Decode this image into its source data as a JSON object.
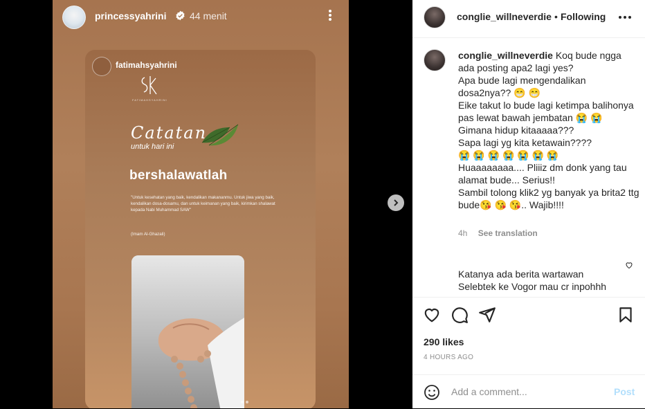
{
  "story": {
    "username": "princessyahrini",
    "time": "44 menit",
    "card": {
      "username": "fatimahsyahrini",
      "logo_text": "FATIMAHSYAHRINI",
      "catatan": "Catatan",
      "untuk": "untuk hari ini",
      "headline": "bershalawatlah",
      "quote": "\"Untuk kesehatan yang baik, kendalikan makananmu. Untuk jiwa yang baik, kendalikan dosa-dosamu, dan untuk keimanan yang baik, kirimkan shalawat kepada Nabi Muhammad SAW\"",
      "quote_author": "(Imam Al-Ghazali)"
    }
  },
  "post": {
    "author": "conglie_willneverdie",
    "separator": "•",
    "following_label": "Following",
    "caption_user": "conglie_willneverdie",
    "caption_body": " Koq bude ngga ada posting apa2 lagi yes?\nApa bude lagi mengendalikan dosa2nya?? 😁 😁\nEike takut lo bude lagi ketimpa balihonya pas lewat bawah jembatan 😭 😭\nGimana hidup kitaaaaa???\nSapa lagi yg kita ketawain????\n😭 😭 😭 😭 😭 😭 😭\nHuaaaaaaaa.... Pliiiz dm donk yang tau alamat bude... Serius!!\nSambil tolong klik2 yg banyak ya brita2 ttg bude😘 😘 😘.. Wajib!!!!",
    "caption_time": "4h",
    "see_translation": "See translation",
    "reply_text": "Katanya ada berita wartawan\nSelebtek ke Vogor mau cr inpohhh",
    "likes": "290 likes",
    "posted": "4 HOURS AGO",
    "comment_placeholder": "Add a comment...",
    "post_label": "Post"
  },
  "icons": {
    "verified": "verified-badge-icon",
    "next": "chevron-right-icon",
    "like": "heart-icon",
    "comment": "comment-bubble-icon",
    "share": "paper-plane-icon",
    "save": "bookmark-icon",
    "emoji": "smiley-icon",
    "more": "more-horizontal-icon"
  },
  "colors": {
    "accent_disabled": "#b2dffc",
    "text": "#262626",
    "muted": "#8e8e8e"
  }
}
